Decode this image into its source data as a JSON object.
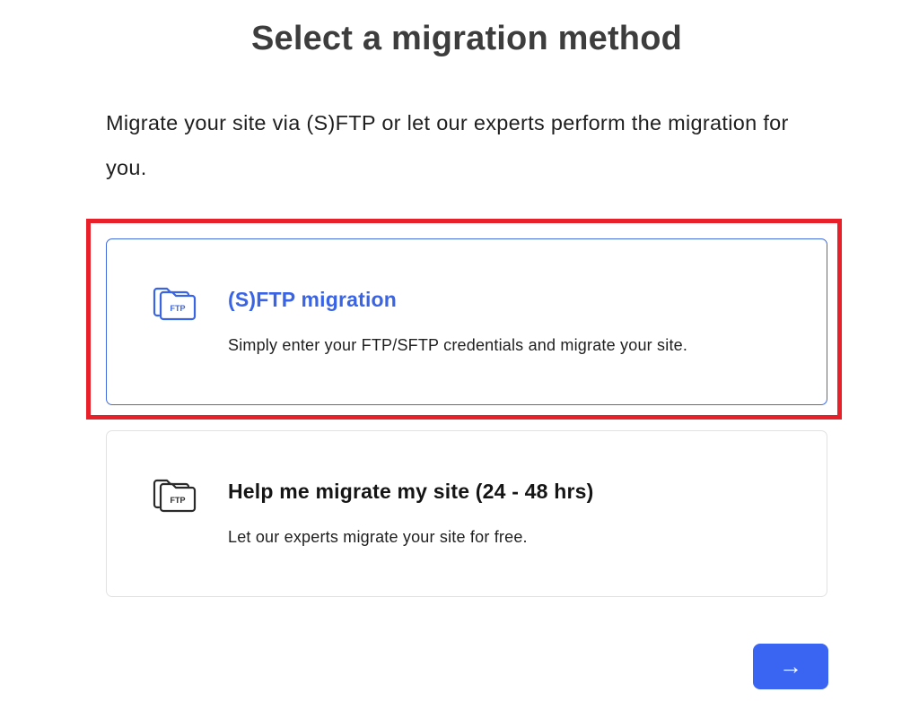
{
  "header": {
    "title": "Select a migration method",
    "subtitle": "Migrate your site via (S)FTP or let our experts perform the migration for you."
  },
  "options": [
    {
      "title": "(S)FTP migration",
      "description": "Simply enter your FTP/SFTP credentials and migrate your site.",
      "icon": "ftp-folder-icon",
      "icon_label": "FTP",
      "selected": true
    },
    {
      "title": "Help me migrate my site (24 - 48 hrs)",
      "description": "Let our experts migrate your site for free.",
      "icon": "ftp-folder-icon",
      "icon_label": "FTP",
      "selected": false
    }
  ],
  "next_button": {
    "label": "→",
    "icon": "arrow-right-icon"
  },
  "colors": {
    "accent": "#3a64f2",
    "selected_border": "#3f6ae0",
    "highlight_annotation": "#e8202a"
  }
}
